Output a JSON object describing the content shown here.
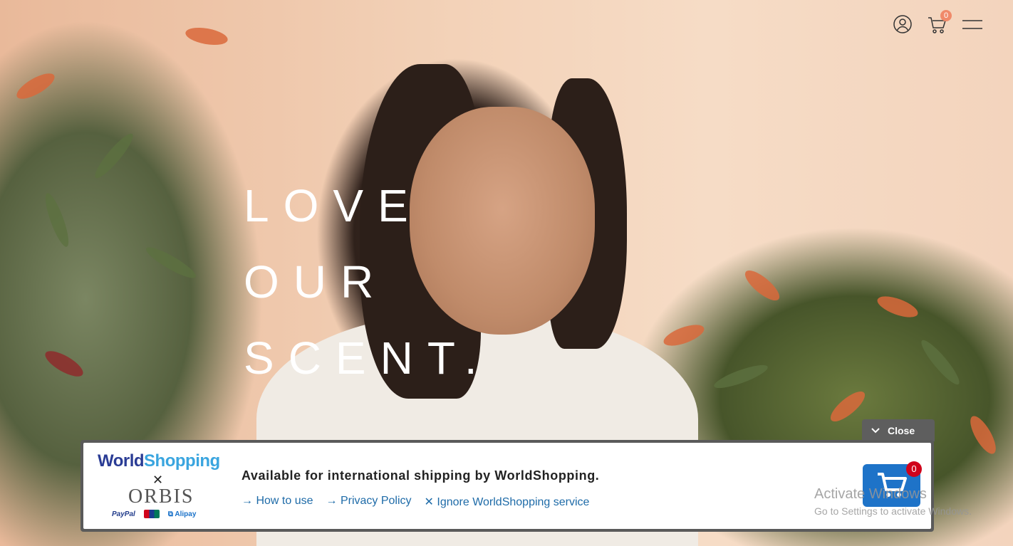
{
  "hero": {
    "lines": [
      "LOVE",
      "OUR",
      "SCENT."
    ]
  },
  "header": {
    "account_icon": "user-circle-icon",
    "cart_icon": "shopping-cart-icon",
    "menu_icon": "hamburger-menu-icon",
    "cart_count": "0",
    "accent_color": "#f08a6a"
  },
  "worldshopping": {
    "close_label": "Close",
    "logo_world": "World",
    "logo_shopping": "Shopping",
    "partner_logo": "ORBIS",
    "payments": {
      "paypal": "PayPal",
      "alipay": "Alipay"
    },
    "message": "Available for international shipping by WorldShopping.",
    "links": [
      "How to use",
      "Privacy Policy",
      "Ignore WorldShopping service"
    ],
    "cart_count": "0",
    "brand_color": "#1e73c8"
  },
  "watermark": {
    "title": "Activate Windows",
    "subtitle": "Go to Settings to activate Windows."
  }
}
